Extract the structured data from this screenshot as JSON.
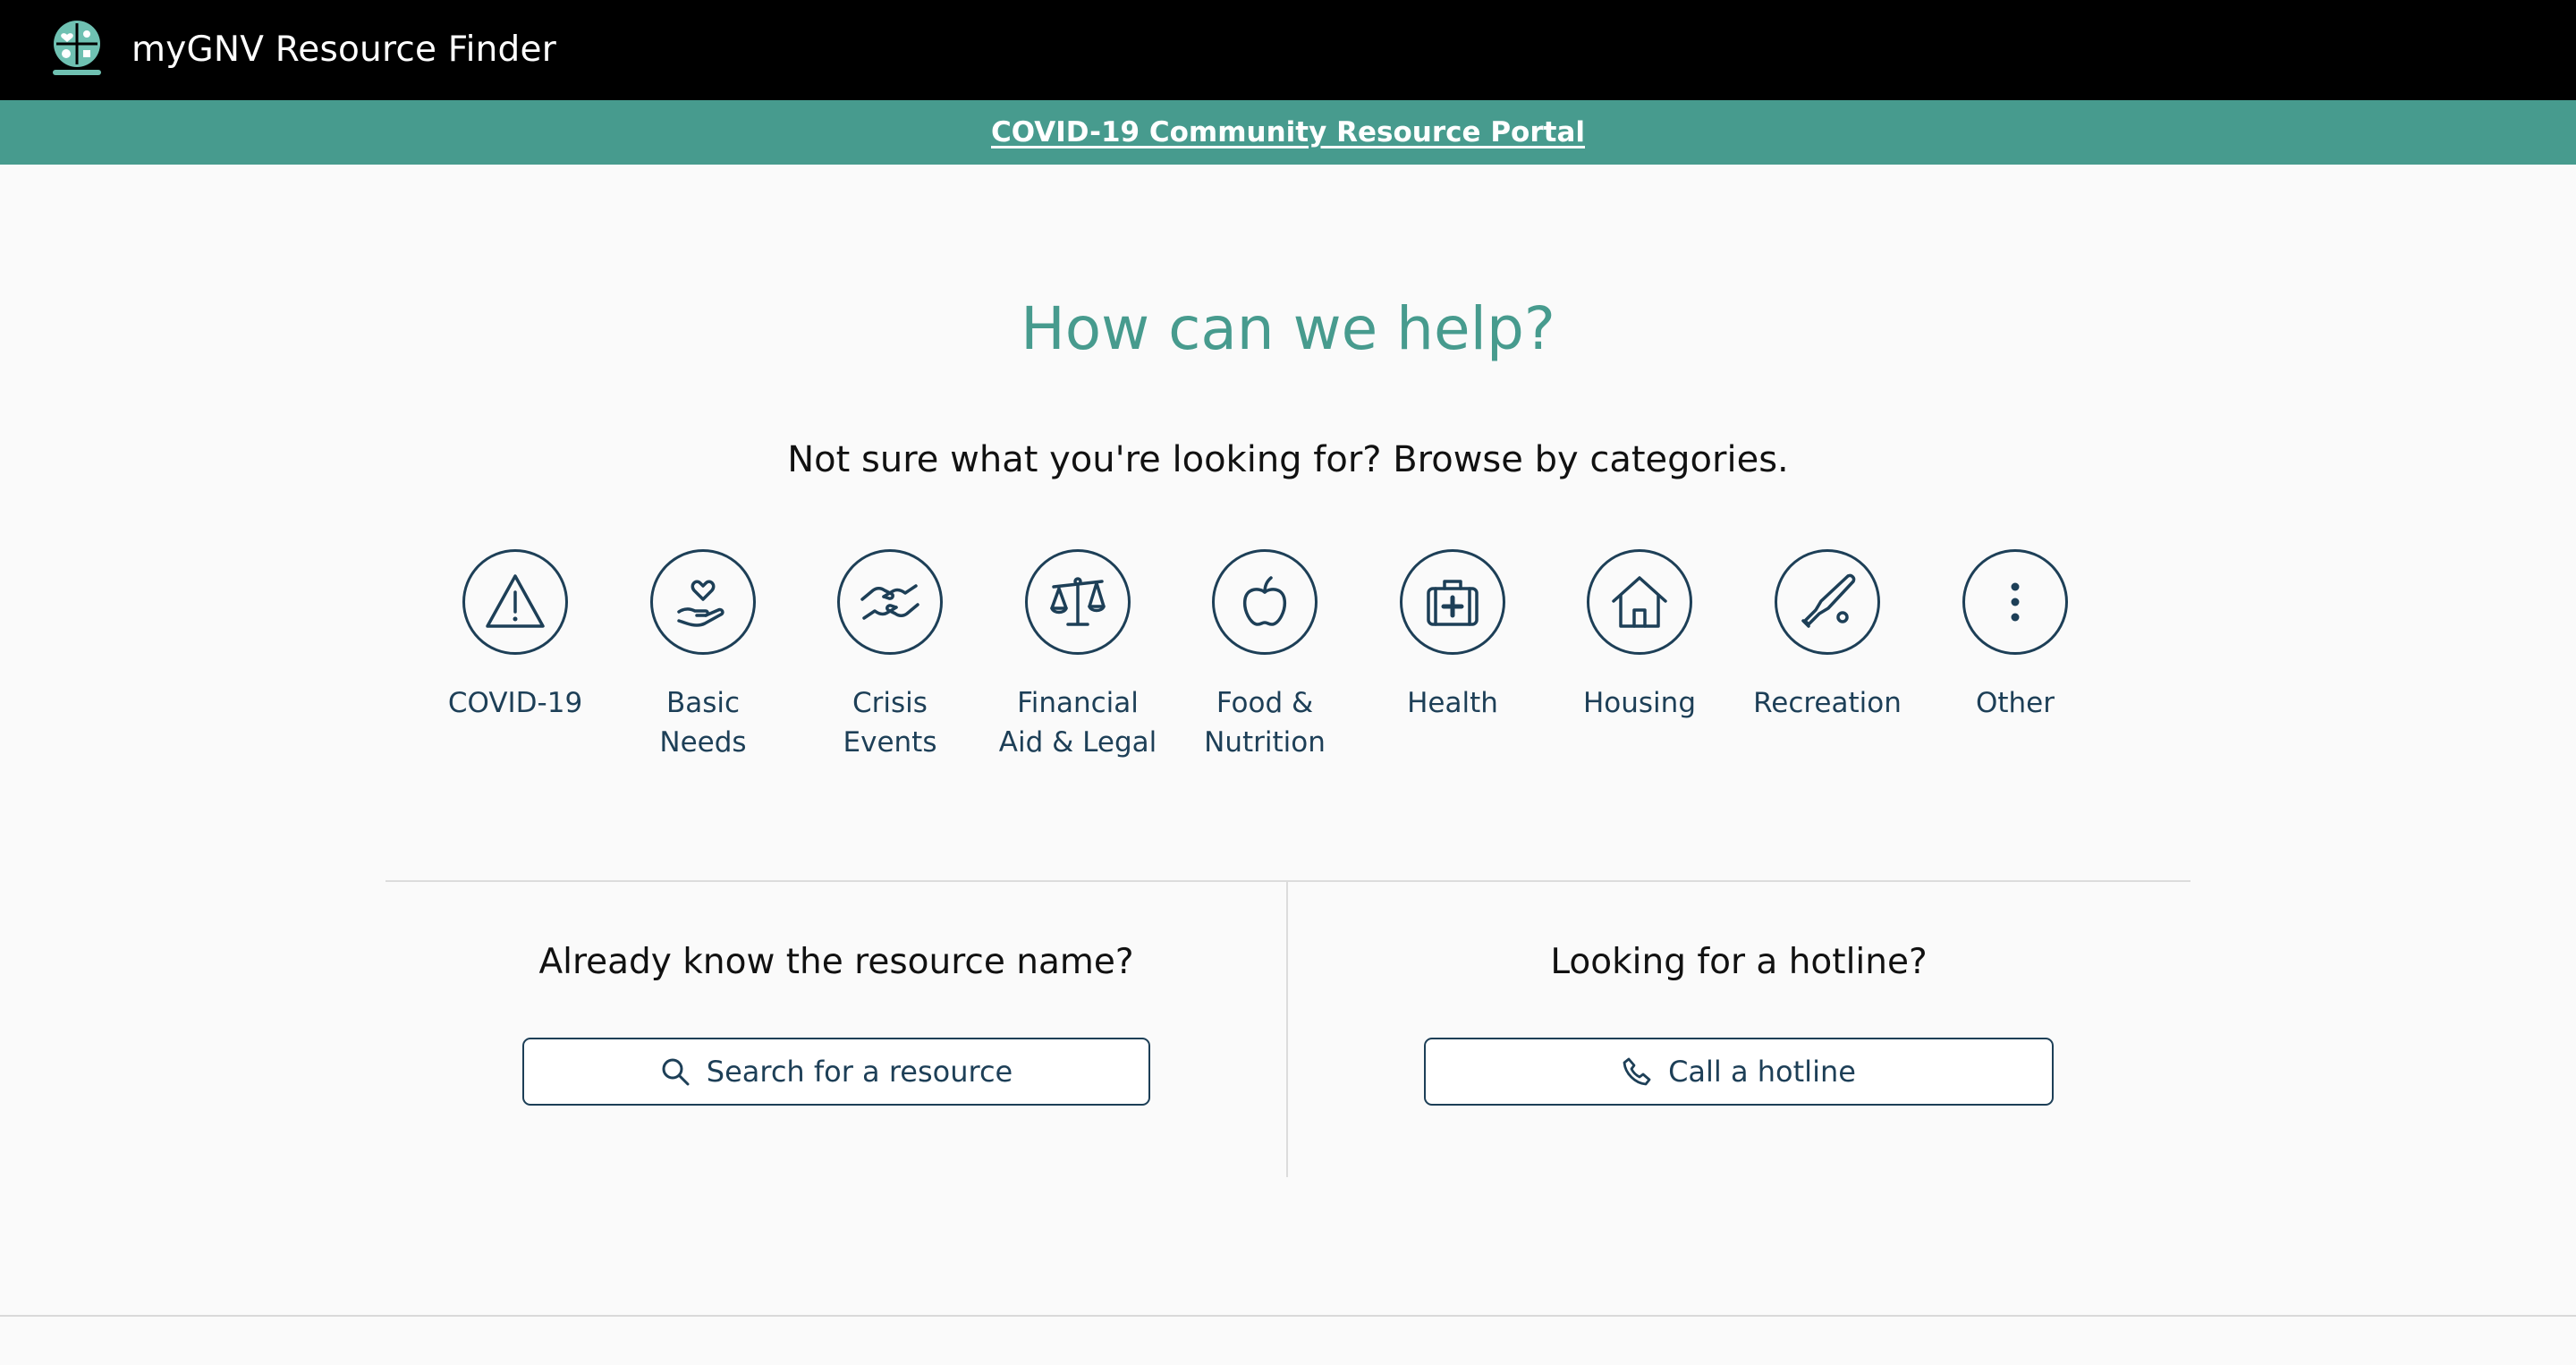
{
  "header": {
    "app_title": "myGNV Resource Finder",
    "logo_icon": "mygnv-logo-icon",
    "background": "#000000"
  },
  "banner": {
    "link_text": "COVID-19 Community Resource Portal",
    "background": "#479b8e"
  },
  "main": {
    "headline": "How can we help?",
    "subline": "Not sure what you're looking for? Browse by categories."
  },
  "categories": [
    {
      "label": "COVID-19",
      "icon": "warning-icon"
    },
    {
      "label": "Basic\nNeeds",
      "icon": "heart-hand-icon"
    },
    {
      "label": "Crisis\nEvents",
      "icon": "helping-hands-icon"
    },
    {
      "label": "Financial\nAid & Legal",
      "icon": "scales-icon"
    },
    {
      "label": "Food &\nNutrition",
      "icon": "apple-icon"
    },
    {
      "label": "Health",
      "icon": "first-aid-kit-icon"
    },
    {
      "label": "Housing",
      "icon": "house-icon"
    },
    {
      "label": "Recreation",
      "icon": "baseball-bat-icon"
    },
    {
      "label": "Other",
      "icon": "more-vertical-icon"
    }
  ],
  "search_panel": {
    "title": "Already know the resource name?",
    "button_label": "Search for a resource",
    "icon": "search-icon"
  },
  "hotline_panel": {
    "title": "Looking for a hotline?",
    "button_label": "Call a hotline",
    "icon": "phone-icon"
  },
  "colors": {
    "accent": "#479b8e",
    "primary_dark": "#1d3f57"
  }
}
